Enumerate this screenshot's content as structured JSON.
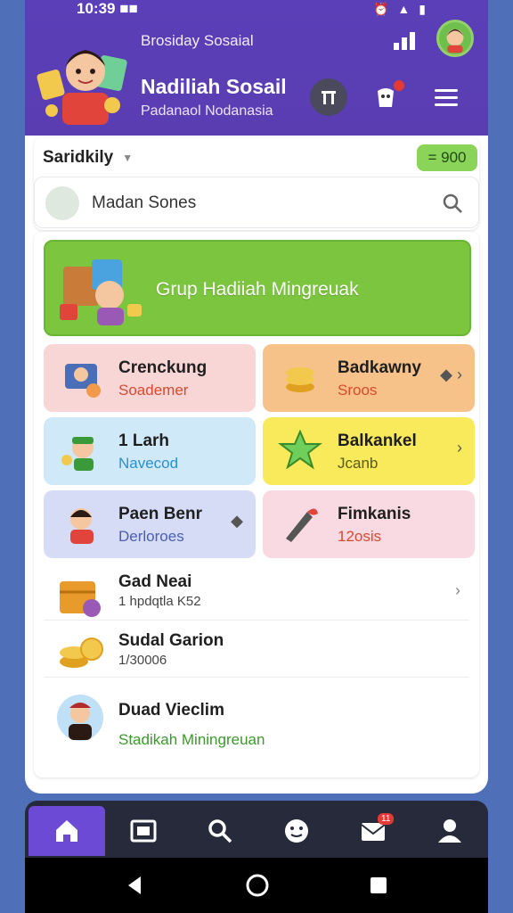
{
  "status": {
    "time": "10:39 ■■",
    "icons": [
      "alarm-icon",
      "wifi-icon",
      "battery-icon"
    ]
  },
  "header": {
    "top_label": "Brosiday Sosaial",
    "title": "Nadiliah Sosail",
    "subtitle": "Padanaol Nodanasia"
  },
  "selector": {
    "label": "Saridkily"
  },
  "balance": {
    "value": "= 900"
  },
  "search": {
    "text": "Madan Sones"
  },
  "banner": {
    "text": "Grup Hadiiah Mingreuak"
  },
  "tiles": [
    {
      "title": "Crenckung",
      "sub": "Soademer",
      "sub_color": "#d84a2e",
      "bg": "#f9d6d6"
    },
    {
      "title": "Badkawny",
      "sub": "Sroos",
      "sub_color": "#d84a2e",
      "bg": "#f7c18a"
    },
    {
      "title": "1 Larh",
      "sub": "Navecod",
      "sub_color": "#2a8fd1",
      "bg": "#cfe9f8"
    },
    {
      "title": "Balkankel",
      "sub": "Jcanb",
      "sub_color": "#5a5a1a",
      "bg": "#f8ea5a"
    },
    {
      "title": "Paen Benr",
      "sub": "Derloroes",
      "sub_color": "#4a5fb0",
      "bg": "#d6dcf6"
    },
    {
      "title": "Fimkanis",
      "sub": "12osis",
      "sub_color": "#d84a2e",
      "bg": "#f9d9e2"
    }
  ],
  "list": [
    {
      "title": "Gad Neai",
      "sub": "1 hpdqtla K52"
    },
    {
      "title": "Sudal Garion",
      "sub": "1/30006"
    },
    {
      "title": "Duad Vieclim",
      "sub": "Stadikah Miningreuan"
    }
  ],
  "nav": [
    "home-icon",
    "gallery-icon",
    "search-icon",
    "emoji-icon",
    "mail-icon",
    "profile-icon"
  ],
  "nav_badge": "11",
  "colors": {
    "header": "#5b3db2",
    "banner": "#7cc63f",
    "accent": "#6d4ad6"
  }
}
